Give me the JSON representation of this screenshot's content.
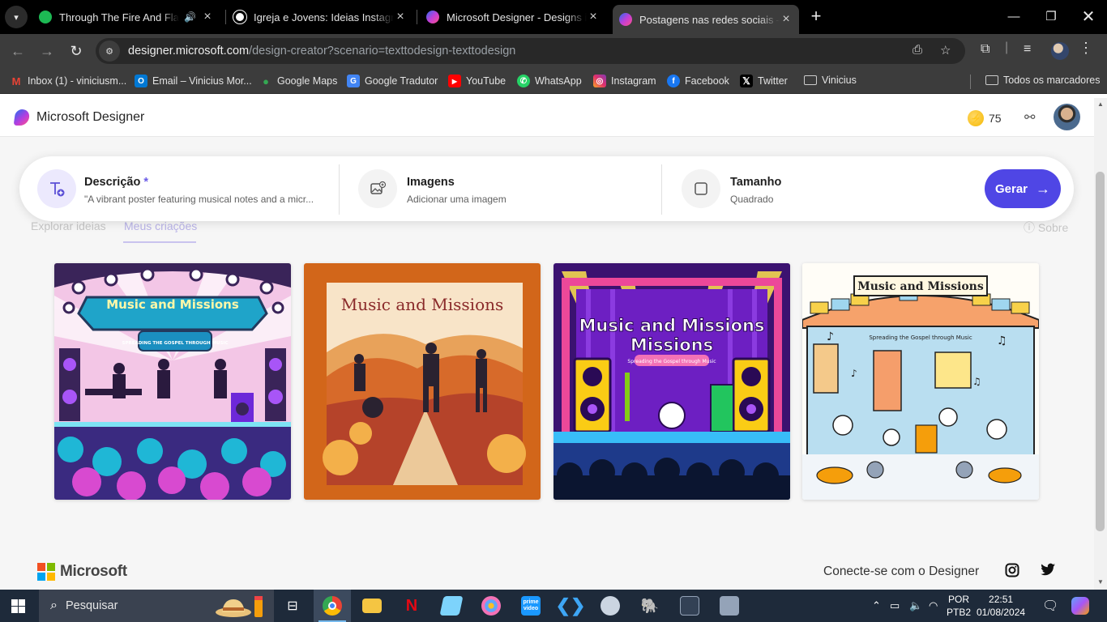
{
  "browser": {
    "tabs": [
      {
        "title": "Through The Fire And Flames",
        "audio": true,
        "favicon_color": "#1DB954"
      },
      {
        "title": "Igreja e Jovens: Ideias Instagram",
        "favicon_color": "#ffffff"
      },
      {
        "title": "Microsoft Designer - Designs in",
        "favicon_color": "#c13fd8"
      },
      {
        "title": "Postagens nas redes sociais – M",
        "favicon_color": "#c13fd8",
        "active": true
      }
    ],
    "url_host": "designer.microsoft.com",
    "url_path": "/design-creator?scenario=texttodesign-texttodesign",
    "bookmarks": [
      {
        "label": "Inbox (1) - viniciusm...",
        "icon": "gmail-icon",
        "color": "#EA4335"
      },
      {
        "label": "Email – Vinicius Mor...",
        "icon": "outlook-icon",
        "color": "#0078D4"
      },
      {
        "label": "Google Maps",
        "icon": "maps-pin-icon",
        "color": "#34A853"
      },
      {
        "label": "Google Tradutor",
        "icon": "translate-icon",
        "color": "#4285F4"
      },
      {
        "label": "YouTube",
        "icon": "youtube-icon",
        "color": "#FF0000"
      },
      {
        "label": "WhatsApp",
        "icon": "whatsapp-icon",
        "color": "#25D366"
      },
      {
        "label": "Instagram",
        "icon": "instagram-icon",
        "color": "#E1306C"
      },
      {
        "label": "Facebook",
        "icon": "facebook-icon",
        "color": "#1877F2"
      },
      {
        "label": "Twitter",
        "icon": "x-icon",
        "color": "#000000"
      },
      {
        "label": "Vinicius",
        "icon": "folder-icon",
        "color": "#cccccc"
      }
    ],
    "all_bookmarks": "Todos os marcadores"
  },
  "app": {
    "title": "Microsoft Designer",
    "credits": "75",
    "accent": "#4f46e5",
    "prompt": {
      "description_label": "Descrição",
      "required_mark": "*",
      "description_value": "\"A vibrant poster featuring musical notes and a micr...",
      "images_label": "Imagens",
      "images_sub": "Adicionar uma imagem",
      "size_label": "Tamanho",
      "size_sub": "Quadrado",
      "generate_label": "Gerar"
    },
    "behind_tabs": [
      "Explorar ideias",
      "Meus criações"
    ],
    "about_label": "Sobre",
    "designs": [
      {
        "title": "Music and Missions",
        "subtitle": "SPREADING THE GOSPEL THROUGH MUSIC"
      },
      {
        "title": "Music and Missions",
        "subtitle": ""
      },
      {
        "title": "Music and Missions",
        "subtitle": "Spreading the Gospel through Music"
      },
      {
        "title": "Music and Missions",
        "subtitle": "Spreading the Gospel through Music"
      }
    ],
    "footer": {
      "brand": "Microsoft",
      "connect": "Conecte-se com o Designer"
    }
  },
  "taskbar": {
    "search_placeholder": "Pesquisar",
    "lang_line1": "POR",
    "lang_line2": "PTB2",
    "time": "22:51",
    "date": "01/08/2024"
  }
}
